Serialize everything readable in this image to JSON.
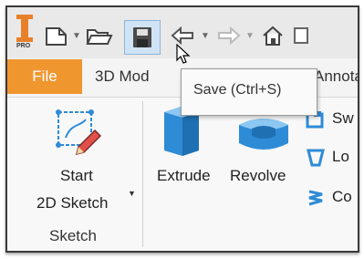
{
  "quick_access": {
    "icons": [
      "app-logo-icon",
      "new-file-icon",
      "open-folder-icon",
      "save-icon",
      "undo-icon",
      "redo-icon",
      "home-icon"
    ],
    "logo_text": "PRO"
  },
  "tabs": {
    "file": "File",
    "model": "3D Mod",
    "annotate": "Annota"
  },
  "tooltip": {
    "text": "Save (Ctrl+S)"
  },
  "ribbon": {
    "start_sketch_line1": "Start",
    "start_sketch_line2": "2D Sketch",
    "extrude": "Extrude",
    "revolve": "Revolve",
    "sketch_group": "Sketch",
    "side_items": [
      "Sw",
      "Lo",
      "Co"
    ]
  },
  "colors": {
    "file_tab": "#f0962f",
    "accent_blue": "#2e8bd6"
  }
}
